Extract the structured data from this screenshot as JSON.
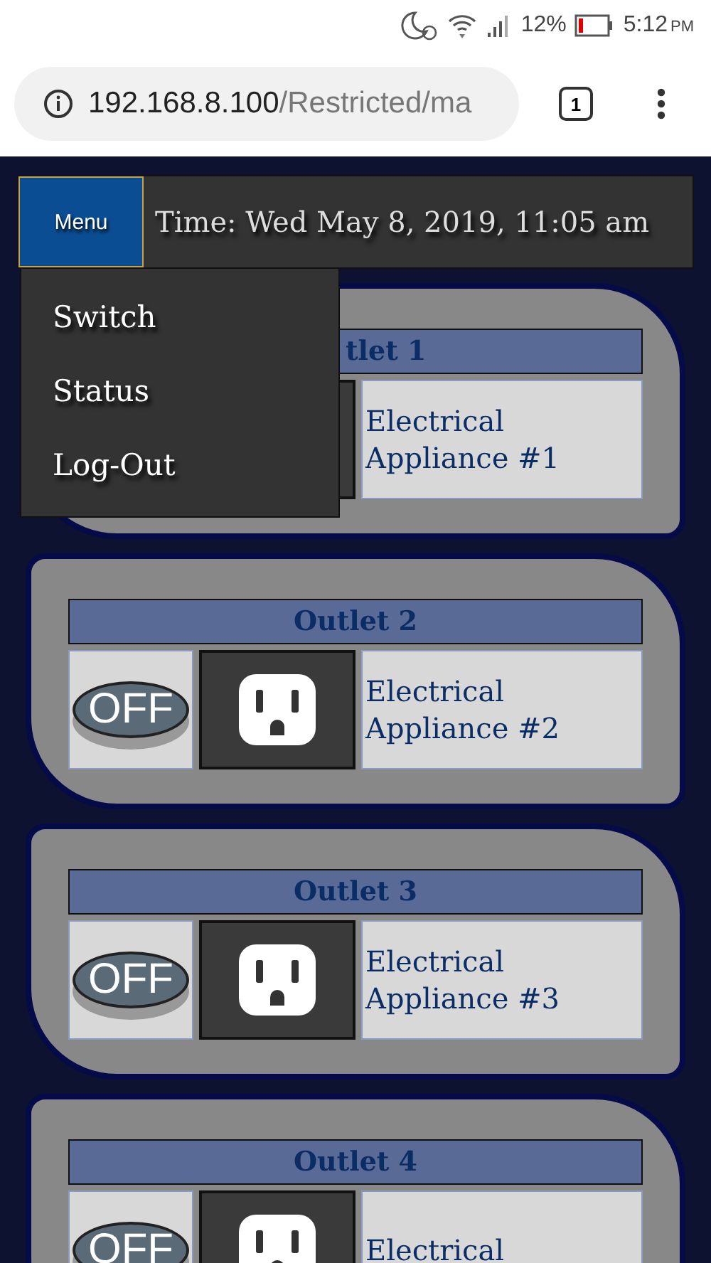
{
  "status_bar": {
    "battery": "12%",
    "time": "5:12",
    "time_suffix": "PM"
  },
  "browser": {
    "url_host": "192.168.8.100",
    "url_path": "/Restricted/ma",
    "tab_count": "1"
  },
  "header": {
    "menu_button": "Menu",
    "time": "Time: Wed May 8, 2019, 11:05 am"
  },
  "menu": {
    "open": true,
    "items": [
      "Switch",
      "Status",
      "Log-Out"
    ]
  },
  "outlets": [
    {
      "title": "tlet 1",
      "under_menu": true,
      "appliance": "Electrical Appliance #1"
    },
    {
      "title": "Outlet 2",
      "switch": {
        "label": "OFF",
        "on": false
      },
      "appliance": "Electrical Appliance #2"
    },
    {
      "title": "Outlet 3",
      "switch": {
        "label": "OFF",
        "on": false
      },
      "appliance": "Electrical Appliance #3"
    },
    {
      "title": "Outlet 4",
      "switch": {
        "label": "OFF",
        "on": false
      },
      "appliance": "Electrical"
    }
  ]
}
